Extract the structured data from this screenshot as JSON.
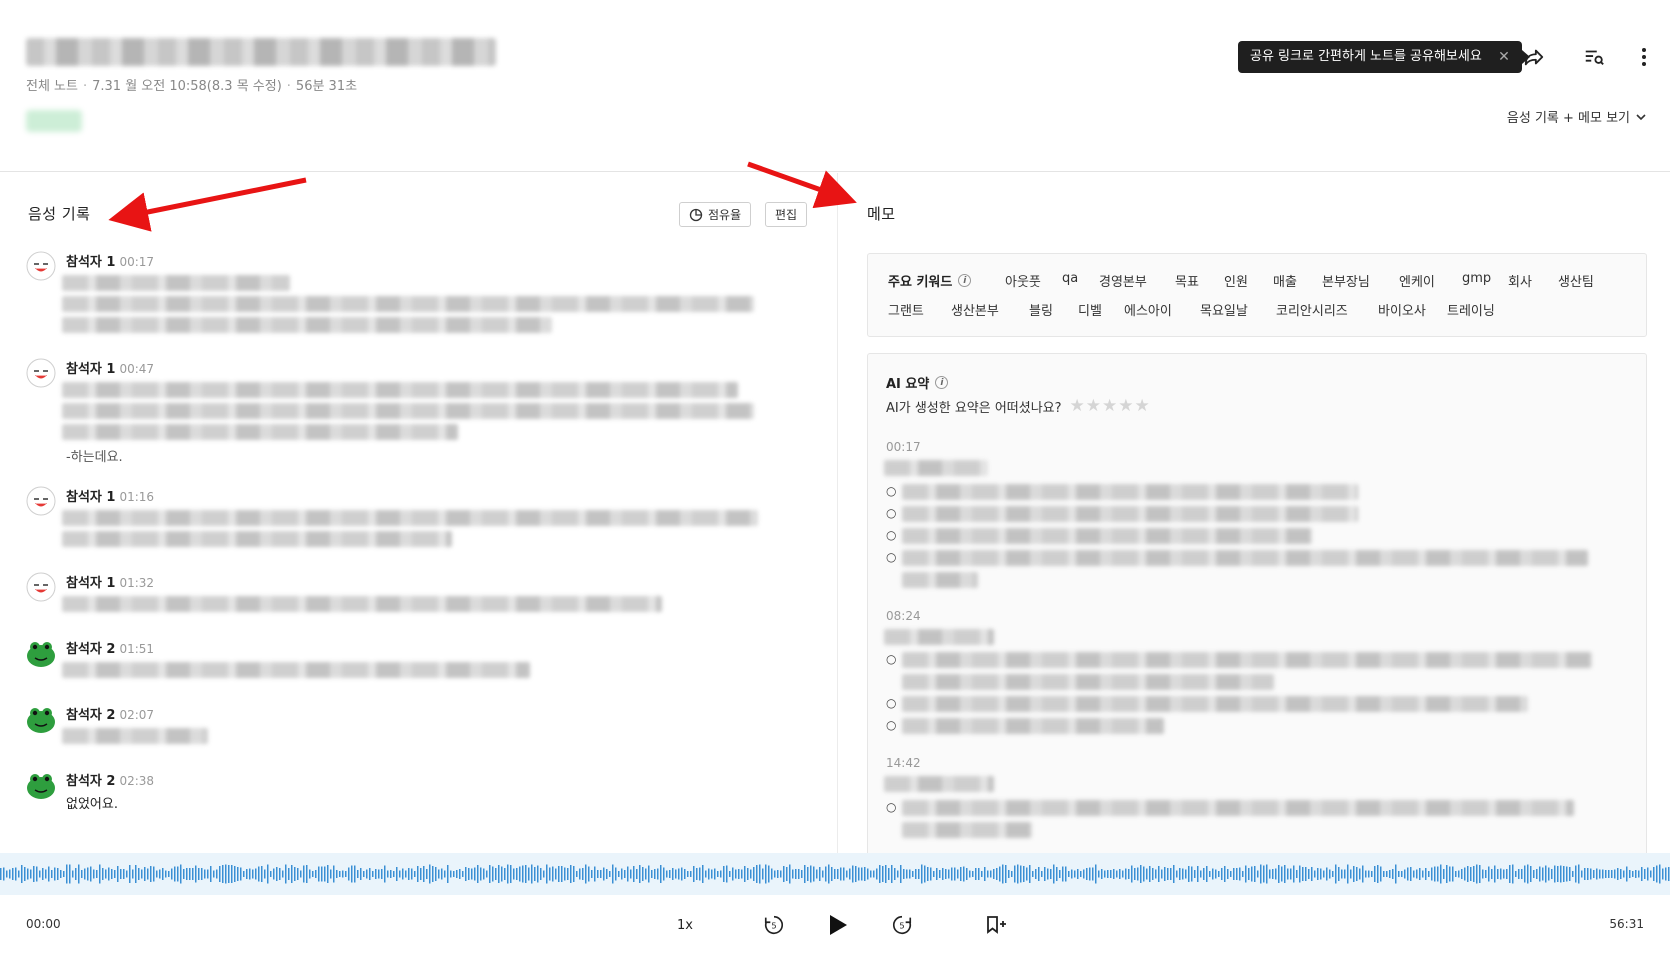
{
  "header": {
    "meta_folder": "전체 노트",
    "meta_date": "7.31 월 오전 10:58(8.3 목 수정)",
    "meta_duration": "56분 31초",
    "tooltip_text": "공유 링크로 간편하게 노트를 공유해보세요",
    "tooltip_close": "✕",
    "icons": [
      "share-icon",
      "search-transcript-icon",
      "more-vertical-icon"
    ],
    "view_mode_label": "음성 기록 + 메모 보기"
  },
  "transcript": {
    "title": "음성 기록",
    "share_ratio_label": "점유율",
    "edit_label": "편집",
    "entries": [
      {
        "speaker": "참석자 1",
        "time": "00:17"
      },
      {
        "speaker": "참석자 1",
        "time": "00:47",
        "visible_text": "-하는데요."
      },
      {
        "speaker": "참석자 1",
        "time": "01:16"
      },
      {
        "speaker": "참석자 1",
        "time": "01:32"
      },
      {
        "speaker": "참석자 2",
        "time": "01:51"
      },
      {
        "speaker": "참석자 2",
        "time": "02:07"
      },
      {
        "speaker": "참석자 2",
        "time": "02:38",
        "visible_text": "없었어요."
      }
    ]
  },
  "memo": {
    "title": "메모",
    "keywords_title": "주요 키워드",
    "keywords_row1": [
      "아웃풋",
      "qa",
      "경영본부",
      "목표",
      "인원",
      "매출",
      "본부장님",
      "엔케이",
      "gmp",
      "회사",
      "생산팀"
    ],
    "keywords_row2": [
      "그랜트",
      "생산본부",
      "블링",
      "디벨",
      "에스아이",
      "목요일날",
      "코리안시리즈",
      "바이오사",
      "트레이닝"
    ],
    "ai_title": "AI 요약",
    "ai_question": "AI가 생성한 요약은 어떠셨나요?",
    "rating": {
      "value": 0,
      "max": 5
    },
    "ai_sections": [
      {
        "time": "00:17"
      },
      {
        "time": "08:24"
      },
      {
        "time": "14:42"
      }
    ]
  },
  "player": {
    "current_time": "00:00",
    "total_time": "56:31",
    "speed": "1x",
    "skip_seconds": "5"
  }
}
